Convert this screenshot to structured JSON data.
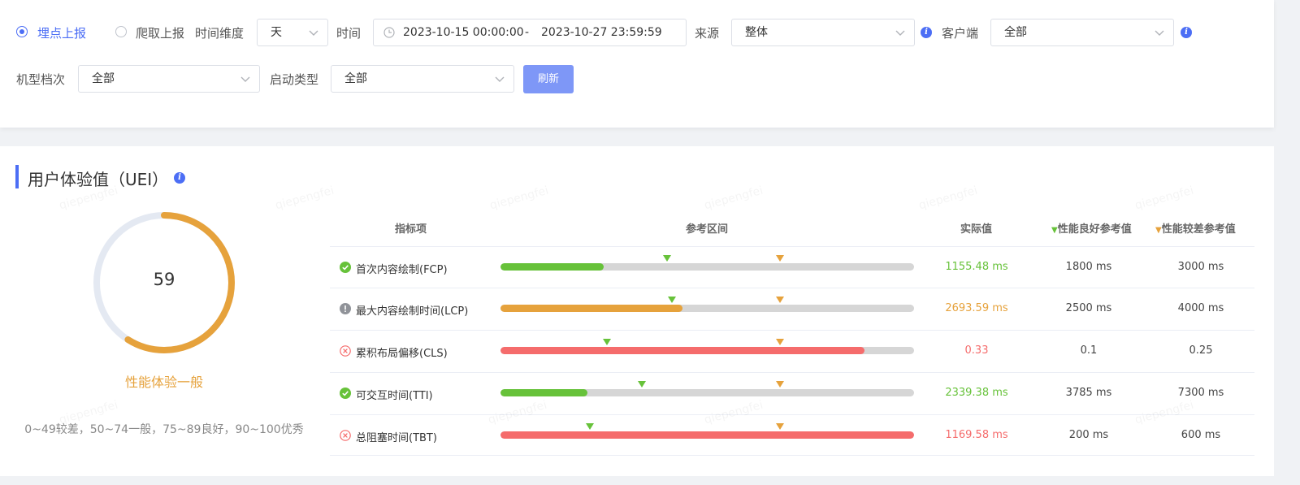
{
  "filters": {
    "report_mode": {
      "options": [
        "埋点上报",
        "爬取上报"
      ],
      "selected": 0
    },
    "dimension_label": "时间维度",
    "dimension_value": "天",
    "time_label": "时间",
    "time_start": "2023-10-15 00:00:00",
    "time_sep": "-",
    "time_end": "2023-10-27 23:59:59",
    "source_label": "来源",
    "source_value": "整体",
    "client_label": "客户端",
    "client_value": "全部",
    "device_label": "机型档次",
    "device_value": "全部",
    "launch_label": "启动类型",
    "launch_value": "全部",
    "refresh_label": "刷新"
  },
  "uei": {
    "title": "用户体验值（UEI）",
    "score": "59",
    "score_value": 59,
    "score_max": 100,
    "verdict": "性能体验一般",
    "legend": "0~49较差，50~74一般，75~89良好，90~100优秀"
  },
  "table": {
    "headers": [
      "指标项",
      "参考区间",
      "实际值",
      "性能良好参考值",
      "性能较差参考值"
    ],
    "rows": [
      {
        "status": "good",
        "name": "首次内容绘制(FCP)",
        "actual": "1155.48 ms",
        "good": "1800 ms",
        "poor": "3000 ms",
        "fill": 0.25,
        "good_mark": 0.403,
        "poor_mark": 0.676
      },
      {
        "status": "warn",
        "name": "最大内容绘制时间(LCP)",
        "actual": "2693.59 ms",
        "good": "2500 ms",
        "poor": "4000 ms",
        "fill": 0.44,
        "good_mark": 0.415,
        "poor_mark": 0.676
      },
      {
        "status": "bad",
        "name": "累积布局偏移(CLS)",
        "actual": "0.33",
        "good": "0.1",
        "poor": "0.25",
        "fill": 0.88,
        "good_mark": 0.257,
        "poor_mark": 0.676
      },
      {
        "status": "good",
        "name": "可交互时间(TTI)",
        "actual": "2339.38 ms",
        "good": "3785 ms",
        "poor": "7300 ms",
        "fill": 0.21,
        "good_mark": 0.342,
        "poor_mark": 0.676
      },
      {
        "status": "bad",
        "name": "总阻塞时间(TBT)",
        "actual": "1169.58 ms",
        "good": "200 ms",
        "poor": "600 ms",
        "fill": 1.0,
        "good_mark": 0.217,
        "poor_mark": 0.676
      }
    ]
  },
  "colors": {
    "accent": "#4c6ef5",
    "good": "#67c23a",
    "warn": "#e6a23c",
    "bad": "#f56c6c",
    "track": "#d6d6d6",
    "ring_bg": "#e4e9f2"
  },
  "watermark": "qiepengfei"
}
